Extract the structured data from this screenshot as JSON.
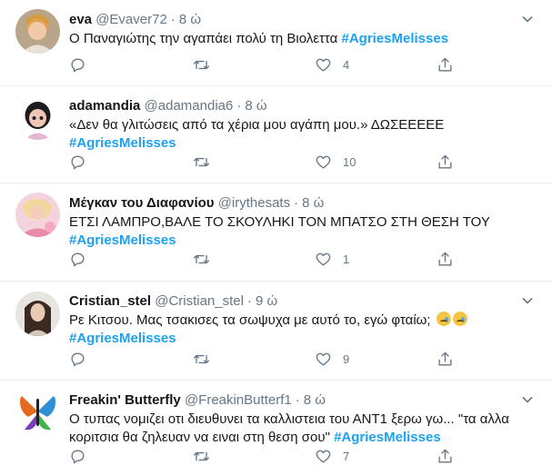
{
  "tweets": [
    {
      "name": "eva",
      "handle": "@Evaver72",
      "dot": "·",
      "time": "8 ώ",
      "text": "Ο Παναγιώτης την αγαπάει πολύ τη Βιολεττα",
      "hashtag": "#AgriesMelisses",
      "reply_count": "",
      "retweet_count": "",
      "like_count": "4"
    },
    {
      "name": "adamandia",
      "handle": "@adamandia6",
      "dot": "·",
      "time": "8 ώ",
      "text": "«Δεν θα γλιτώσεις από τα χέρια μου αγάπη μου.» ΔΩΣΕΕΕΕΕ",
      "hashtag": "#AgriesMelisses",
      "reply_count": "",
      "retweet_count": "",
      "like_count": "10"
    },
    {
      "name": "Μέγκαν του Διαφανίου",
      "handle": "@irythesats",
      "dot": "·",
      "time": "8 ώ",
      "text": "ΕΤΣΙ ΛΑΜΠΡΟ,ΒΑΛΕ ΤΟ ΣΚΟΥΛΗΚΙ ΤΟΝ ΜΠΑΤΣΟ ΣΤΗ ΘΕΣΗ ΤΟΥ",
      "hashtag": "#AgriesMelisses",
      "reply_count": "",
      "retweet_count": "",
      "like_count": "1"
    },
    {
      "name": "Cristian_stel",
      "handle": "@Cristian_stel",
      "dot": "·",
      "time": "9 ώ",
      "text": "Ρε Κιτσου. Μας τσακισες τα σωψυχα με αυτό το, εγώ φταίω;",
      "hashtag": "#AgriesMelisses",
      "reply_count": "",
      "retweet_count": "",
      "like_count": "9"
    },
    {
      "name": "Freakin' Butterfly",
      "handle": "@FreakinButterf1",
      "dot": "·",
      "time": "8 ώ",
      "text": "Ο τυπας νομιζει οτι διευθυνει τα καλλιστεια του ΑΝΤ1 ξερω γω... \"τα αλλα κοριτσια θα ζηλευαν να ειναι στη θεση σου\"",
      "hashtag": "#AgriesMelisses",
      "reply_count": "",
      "retweet_count": "",
      "like_count": "7"
    }
  ],
  "icons": {
    "reply": "reply-icon",
    "retweet": "retweet-icon",
    "like": "heart-icon",
    "share": "share-icon",
    "more": "chevron-down-icon"
  },
  "colors": {
    "hashtag": "#1da1f2",
    "secondary": "#657786",
    "border": "#e6ecf0"
  }
}
